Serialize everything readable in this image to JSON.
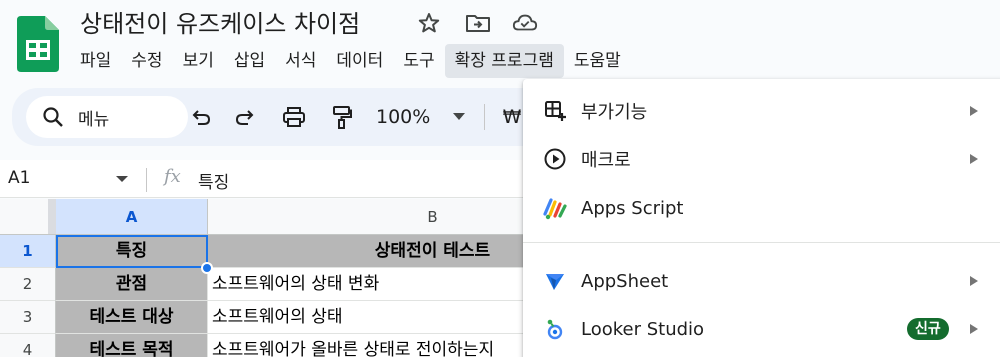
{
  "app": {
    "doc_title": "상태전이 유즈케이스 차이점",
    "brand_green": "#0f9d58",
    "accent_blue": "#1a73e8"
  },
  "menubar": {
    "items": [
      "파일",
      "수정",
      "보기",
      "삽입",
      "서식",
      "데이터",
      "도구",
      "확장 프로그램",
      "도움말"
    ],
    "active": "확장 프로그램"
  },
  "toolbar": {
    "search_label": "메뉴",
    "zoom": "100%",
    "currency": "₩"
  },
  "formula_bar": {
    "cell_ref": "A1",
    "fx": "fx",
    "content": "특징"
  },
  "grid": {
    "columns": [
      "A",
      "B"
    ],
    "rows": [
      {
        "num": "1",
        "a": "특징",
        "b": "상태전이 테스트"
      },
      {
        "num": "2",
        "a": "관점",
        "b": "소프트웨어의 상태 변화"
      },
      {
        "num": "3",
        "a": "테스트 대상",
        "b": "소프트웨어의 상태"
      },
      {
        "num": "4",
        "a": "테스트 목적",
        "b": "소프트웨어가 올바른 상태로 전이하는지"
      }
    ]
  },
  "extensions_menu": {
    "items": [
      {
        "label": "부가기능",
        "icon": "addons-icon",
        "has_submenu": true
      },
      {
        "label": "매크로",
        "icon": "play-circle-icon",
        "has_submenu": true
      },
      {
        "label": "Apps Script",
        "icon": "apps-script-icon",
        "has_submenu": false
      },
      {
        "label": "AppSheet",
        "icon": "appsheet-icon",
        "has_submenu": true
      },
      {
        "label": "Looker Studio",
        "icon": "looker-studio-icon",
        "has_submenu": true,
        "badge": "신규"
      }
    ]
  }
}
